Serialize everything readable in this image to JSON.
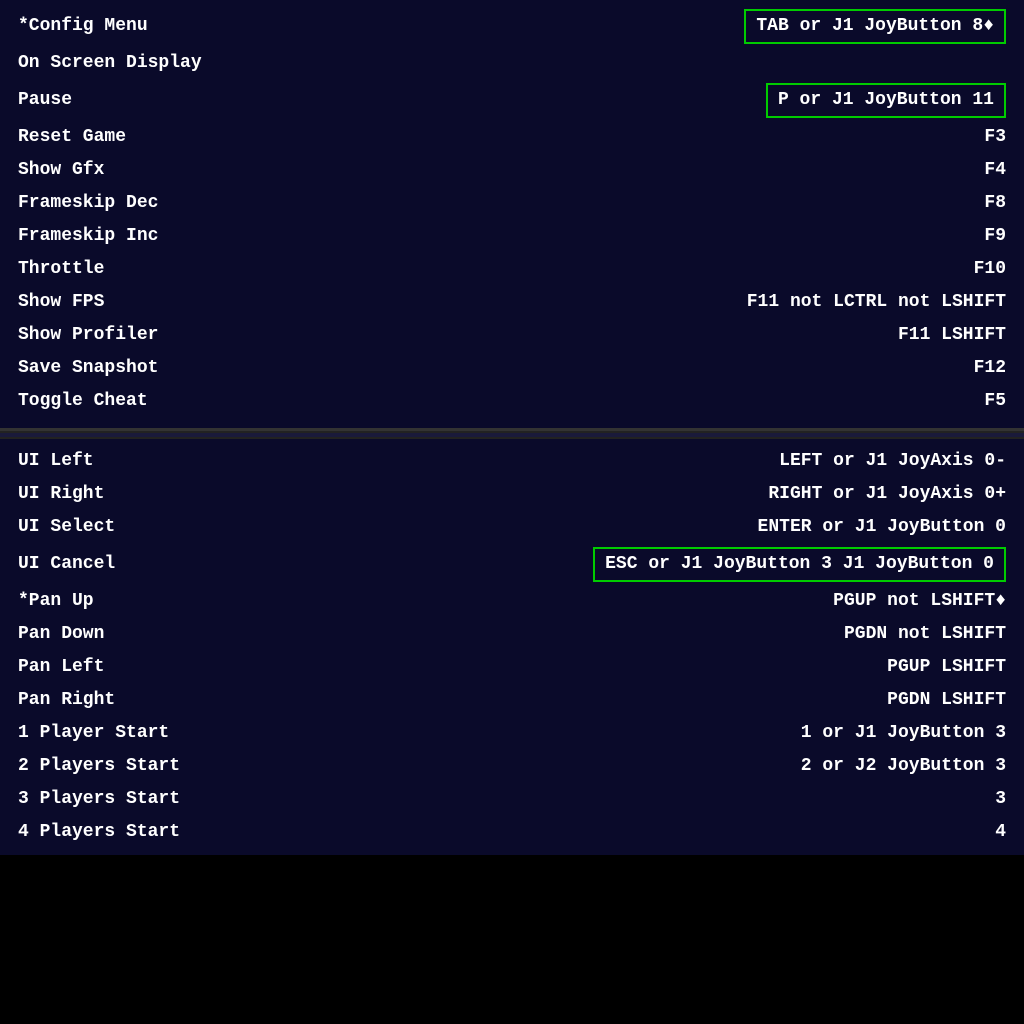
{
  "top_section": {
    "rows": [
      {
        "id": "config-menu",
        "label": "*Config Menu",
        "value": "TAB or J1 JoyButton 8♦",
        "highlighted": true,
        "arrow_right": false
      },
      {
        "id": "on-screen-display",
        "label": "On Screen Display",
        "value": "",
        "highlighted": false
      },
      {
        "id": "pause",
        "label": "Pause",
        "value": "P or J1 JoyButton 11",
        "highlighted": true
      },
      {
        "id": "reset-game",
        "label": "Reset Game",
        "value": "F3",
        "highlighted": false
      },
      {
        "id": "show-gfx",
        "label": "Show Gfx",
        "value": "F4",
        "highlighted": false
      },
      {
        "id": "frameskip-dec",
        "label": "Frameskip Dec",
        "value": "F8",
        "highlighted": false
      },
      {
        "id": "frameskip-inc",
        "label": "Frameskip Inc",
        "value": "F9",
        "highlighted": false
      },
      {
        "id": "throttle",
        "label": "Throttle",
        "value": "F10",
        "highlighted": false
      },
      {
        "id": "show-fps",
        "label": "Show FPS",
        "value": "F11 not LCTRL not LSHIFT",
        "highlighted": false
      },
      {
        "id": "show-profiler",
        "label": "Show Profiler",
        "value": "F11 LSHIFT",
        "highlighted": false
      },
      {
        "id": "save-snapshot",
        "label": "Save Snapshot",
        "value": "F12",
        "highlighted": false
      },
      {
        "id": "toggle-cheat",
        "label": "Toggle Cheat",
        "value": "F5",
        "highlighted": false
      }
    ]
  },
  "bottom_section": {
    "rows": [
      {
        "id": "ui-left",
        "label": "UI Left",
        "value": "LEFT or J1 JoyAxis 0-",
        "highlighted": false
      },
      {
        "id": "ui-right",
        "label": "UI Right",
        "value": "RIGHT or J1 JoyAxis 0+",
        "highlighted": false
      },
      {
        "id": "ui-select",
        "label": "UI Select",
        "value": "ENTER or J1 JoyButton 0",
        "highlighted": false
      },
      {
        "id": "ui-cancel",
        "label": "UI Cancel",
        "value": "ESC or J1 JoyButton 3 J1 JoyButton 0",
        "highlighted": true
      },
      {
        "id": "pan-up",
        "label": "*Pan Up",
        "value": "PGUP not LSHIFT♦",
        "highlighted": false
      },
      {
        "id": "pan-down",
        "label": "Pan Down",
        "value": "PGDN not LSHIFT",
        "highlighted": false
      },
      {
        "id": "pan-left",
        "label": "Pan Left",
        "value": "PGUP LSHIFT",
        "highlighted": false
      },
      {
        "id": "pan-right",
        "label": "Pan Right",
        "value": "PGDN LSHIFT",
        "highlighted": false
      },
      {
        "id": "1-player-start",
        "label": "1 Player Start",
        "value": "1 or J1 JoyButton 3",
        "highlighted": false
      },
      {
        "id": "2-players-start",
        "label": "2 Players Start",
        "value": "2 or J2 JoyButton 3",
        "highlighted": false
      },
      {
        "id": "3-players-start",
        "label": "3 Players Start",
        "value": "3",
        "highlighted": false
      },
      {
        "id": "4-players-start",
        "label": "4 Players Start",
        "value": "4",
        "highlighted": false
      }
    ]
  }
}
